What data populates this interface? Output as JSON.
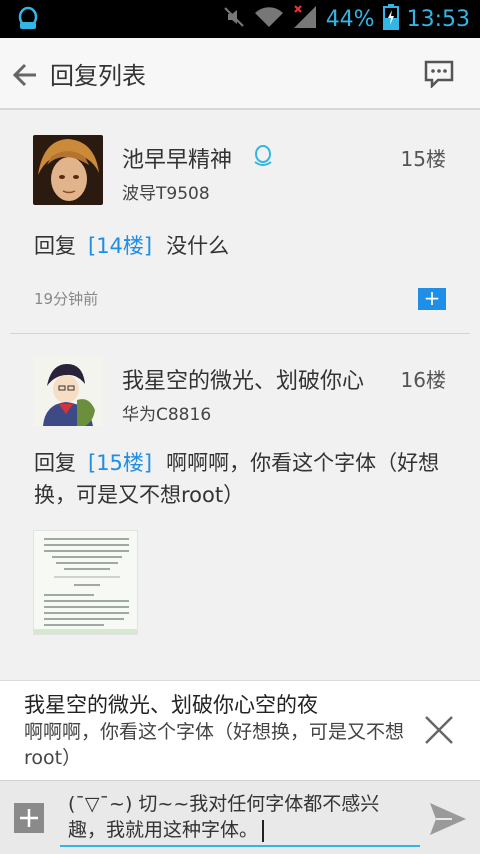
{
  "status_bar": {
    "battery": "44%",
    "time": "13:53",
    "icons": [
      "qq-notification-icon",
      "mute-icon",
      "wifi-icon",
      "signal-icon",
      "battery-charging-icon"
    ]
  },
  "action_bar": {
    "title": "回复列表",
    "back_icon": "back-arrow-icon",
    "chat_icon": "chat-bubble-icon"
  },
  "posts": [
    {
      "username": "池早早精神",
      "device": "波导T9508",
      "floor": "15楼",
      "reply_tag": "[14楼]",
      "reply_prefix": "回复",
      "text": "没什么",
      "time": "19分钟前",
      "badge": "+"
    },
    {
      "username": "我星空的微光、划破你心",
      "device": "华为C8816",
      "floor": "16楼",
      "reply_tag": "[15楼]",
      "reply_prefix": "回复",
      "text": "啊啊啊，你看这个字体（好想换，可是又不想root）"
    }
  ],
  "quote": {
    "name": "我星空的微光、划破你心空的夜",
    "text": "啊啊啊，你看这个字体（好想换，可是又不想root）"
  },
  "input": {
    "value": "(¯▽¯~) 切~~我对任何字体都不感兴趣，我就用这种字体。"
  },
  "colors": {
    "accent": "#33b5e5",
    "link": "#1e8ee6",
    "status_bg": "#000000"
  }
}
